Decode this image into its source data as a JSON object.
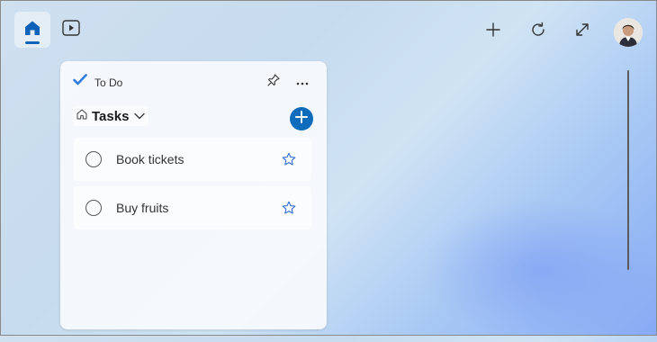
{
  "topbar": {
    "home_icon": "home-icon",
    "video_icon": "video-play-icon",
    "add_icon": "add-icon",
    "refresh_icon": "refresh-icon",
    "expand_icon": "expand-icon",
    "avatar_icon": "user-avatar"
  },
  "widget": {
    "app_name": "To Do",
    "list_name": "Tasks",
    "tasks": [
      {
        "text": "Book tickets"
      },
      {
        "text": "Buy fruits"
      }
    ]
  },
  "colors": {
    "accent": "#0f6cbd",
    "home_accent": "#0f62b9"
  }
}
